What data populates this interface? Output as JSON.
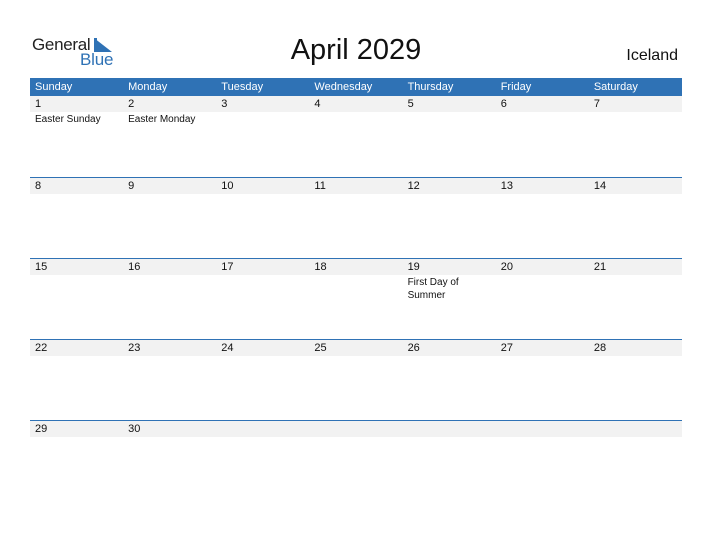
{
  "logo": {
    "general": "General",
    "blue": "Blue"
  },
  "title": "April 2029",
  "country": "Iceland",
  "colors": {
    "accent": "#2f72b5",
    "row_bg": "#f2f2f2"
  },
  "weekdays": [
    "Sunday",
    "Monday",
    "Tuesday",
    "Wednesday",
    "Thursday",
    "Friday",
    "Saturday"
  ],
  "weeks": [
    {
      "days": [
        "1",
        "2",
        "3",
        "4",
        "5",
        "6",
        "7"
      ],
      "events": [
        "Easter Sunday",
        "Easter Monday",
        "",
        "",
        "",
        "",
        ""
      ]
    },
    {
      "days": [
        "8",
        "9",
        "10",
        "11",
        "12",
        "13",
        "14"
      ],
      "events": [
        "",
        "",
        "",
        "",
        "",
        "",
        ""
      ]
    },
    {
      "days": [
        "15",
        "16",
        "17",
        "18",
        "19",
        "20",
        "21"
      ],
      "events": [
        "",
        "",
        "",
        "",
        "First Day of Summer",
        "",
        ""
      ]
    },
    {
      "days": [
        "22",
        "23",
        "24",
        "25",
        "26",
        "27",
        "28"
      ],
      "events": [
        "",
        "",
        "",
        "",
        "",
        "",
        ""
      ]
    },
    {
      "days": [
        "29",
        "30",
        "",
        "",
        "",
        "",
        ""
      ],
      "events": [
        "",
        "",
        "",
        "",
        "",
        "",
        ""
      ]
    }
  ]
}
